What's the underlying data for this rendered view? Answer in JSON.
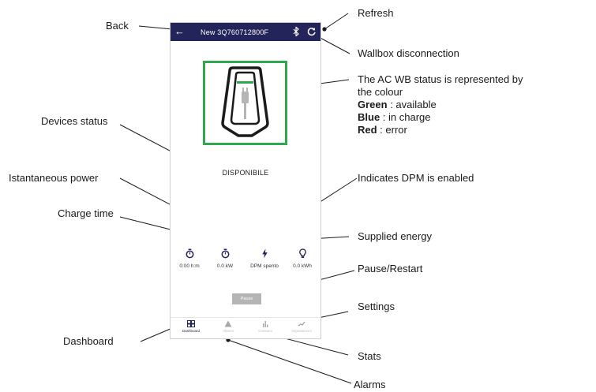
{
  "app": {
    "title": "New 3Q760712800F",
    "status": "DISPONIBILE",
    "status_color": "#2fa84f",
    "header_color": "#22245a",
    "stats": [
      {
        "icon": "stopwatch-icon",
        "value": "0:00 h:m"
      },
      {
        "icon": "stopwatch-icon",
        "value": "0.0 kW"
      },
      {
        "icon": "lightning-icon",
        "value": "DPM spento"
      },
      {
        "icon": "bulb-icon",
        "value": "0.0 kWh"
      }
    ],
    "pause_label": "Pause",
    "nav": [
      {
        "icon": "dashboard-icon",
        "label": "Dashboard",
        "active": true
      },
      {
        "icon": "warning-icon",
        "label": "Allarmi"
      },
      {
        "icon": "bar-chart-icon",
        "label": "Consumi"
      },
      {
        "icon": "settings-icon",
        "label": "Impostazioni"
      }
    ]
  },
  "callouts": {
    "back": "Back",
    "refresh": "Refresh",
    "disconnection": "Wallbox disconnection",
    "status_line1": "The AC WB status is represented by",
    "status_line2": "the colour",
    "green_label": "Green",
    "green_desc": " : available",
    "blue_label": "Blue",
    "blue_desc": " : in charge",
    "red_label": "Red",
    "red_desc": " : error",
    "devices_status": "Devices status",
    "power": "Istantaneous power",
    "dpm": "Indicates DPM is enabled",
    "charge_time": "Charge time",
    "energy": "Supplied energy",
    "pause": "Pause/Restart",
    "settings": "Settings",
    "dashboard": "Dashboard",
    "stats": "Stats",
    "alarms": "Alarms"
  }
}
